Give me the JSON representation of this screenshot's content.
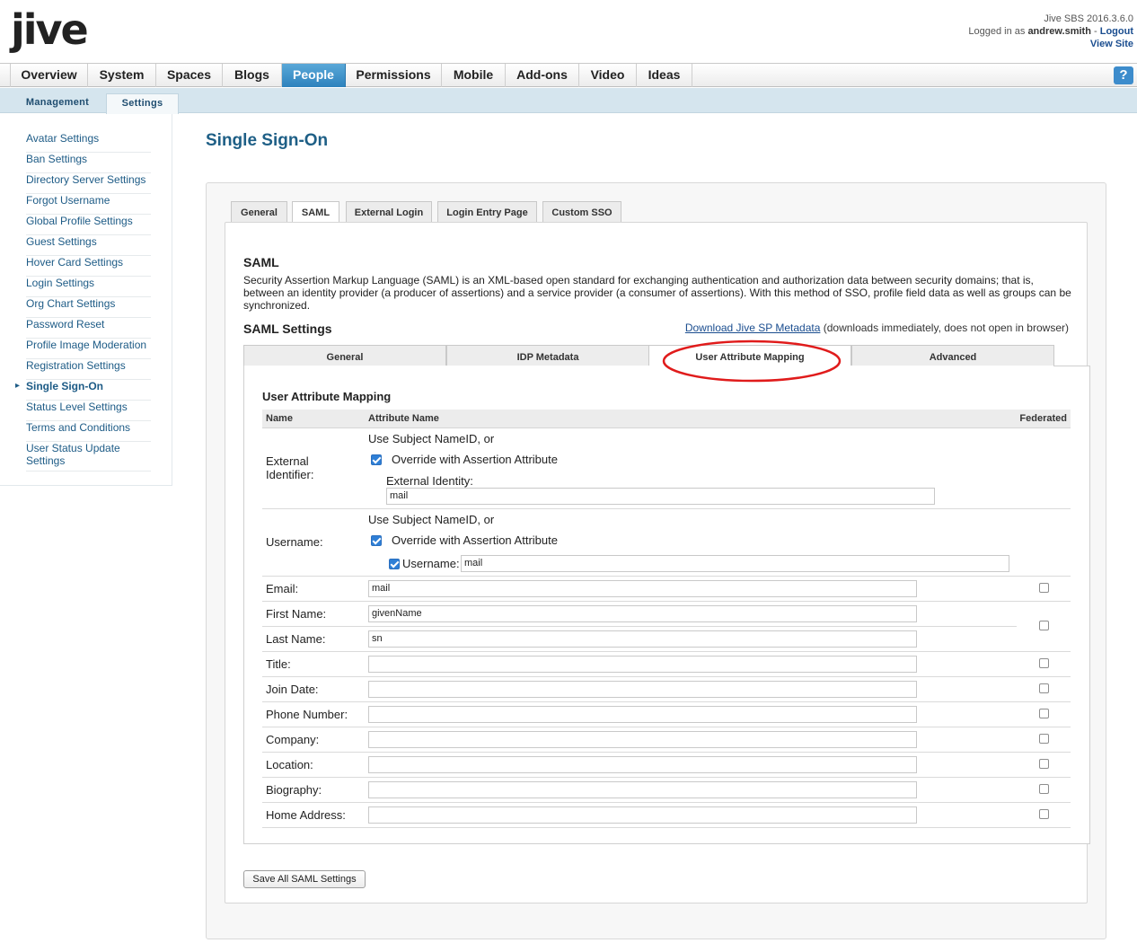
{
  "header": {
    "logo": "jive",
    "version": "Jive SBS 2016.3.6.0",
    "logged_in_prefix": "Logged in as",
    "username": "andrew.smith",
    "separator": "-",
    "logout": "Logout",
    "view_site": "View Site"
  },
  "main_nav": {
    "tabs": [
      "Overview",
      "System",
      "Spaces",
      "Blogs",
      "People",
      "Permissions",
      "Mobile",
      "Add-ons",
      "Video",
      "Ideas"
    ],
    "active": "People",
    "help": "?"
  },
  "sub_nav": {
    "tabs": [
      "Management",
      "Settings"
    ],
    "active": "Settings"
  },
  "sidebar": {
    "items": [
      "Avatar Settings",
      "Ban Settings",
      "Directory Server Settings",
      "Forgot Username",
      "Global Profile Settings",
      "Guest Settings",
      "Hover Card Settings",
      "Login Settings",
      "Org Chart Settings",
      "Password Reset",
      "Profile Image Moderation",
      "Registration Settings",
      "Single Sign-On",
      "Status Level Settings",
      "Terms and Conditions",
      "User Status Update Settings"
    ],
    "active": "Single Sign-On"
  },
  "page_title": "Single Sign-On",
  "sso_tabs": [
    "General",
    "SAML",
    "External Login",
    "Login Entry Page",
    "Custom SSO"
  ],
  "sso_active_tab": "SAML",
  "saml": {
    "heading": "SAML",
    "description": "Security Assertion Markup Language (SAML) is an XML-based open standard for exchanging authentication and authorization data between security domains; that is, between an identity provider (a producer of assertions) and a service provider (a consumer of assertions). With this method of SSO, profile field data as well as groups can be synchronized.",
    "settings_heading": "SAML Settings",
    "download_link": "Download Jive SP Metadata",
    "download_note": "(downloads immediately, does not open in browser)",
    "tabs": [
      "General",
      "IDP Metadata",
      "User Attribute Mapping",
      "Advanced"
    ],
    "active_tab": "User Attribute Mapping",
    "highlight_color": "#e01b1b"
  },
  "mapping": {
    "heading": "User Attribute Mapping",
    "col_name": "Name",
    "col_attr": "Attribute Name",
    "col_fed": "Federated",
    "external_identifier": {
      "label": "External Identifier:",
      "subject_nameid": "Use Subject NameID, or",
      "override": "Override with Assertion Attribute",
      "override_checked": true,
      "identity_label": "External Identity:",
      "identity_value": "mail"
    },
    "username": {
      "label": "Username:",
      "subject_nameid": "Use Subject NameID, or",
      "override": "Override with Assertion Attribute",
      "override_checked": true,
      "field_label": "Username:",
      "field_checked": true,
      "field_value": "mail"
    },
    "fields": [
      {
        "label": "Email:",
        "value": "mail"
      },
      {
        "label": "First Name:",
        "value": "givenName"
      },
      {
        "label": "Last Name:",
        "value": "sn"
      },
      {
        "label": "Title:",
        "value": ""
      },
      {
        "label": "Join Date:",
        "value": ""
      },
      {
        "label": "Phone Number:",
        "value": ""
      },
      {
        "label": "Company:",
        "value": ""
      },
      {
        "label": "Location:",
        "value": ""
      },
      {
        "label": "Biography:",
        "value": ""
      },
      {
        "label": "Home Address:",
        "value": ""
      }
    ]
  },
  "save_button": "Save All SAML Settings"
}
